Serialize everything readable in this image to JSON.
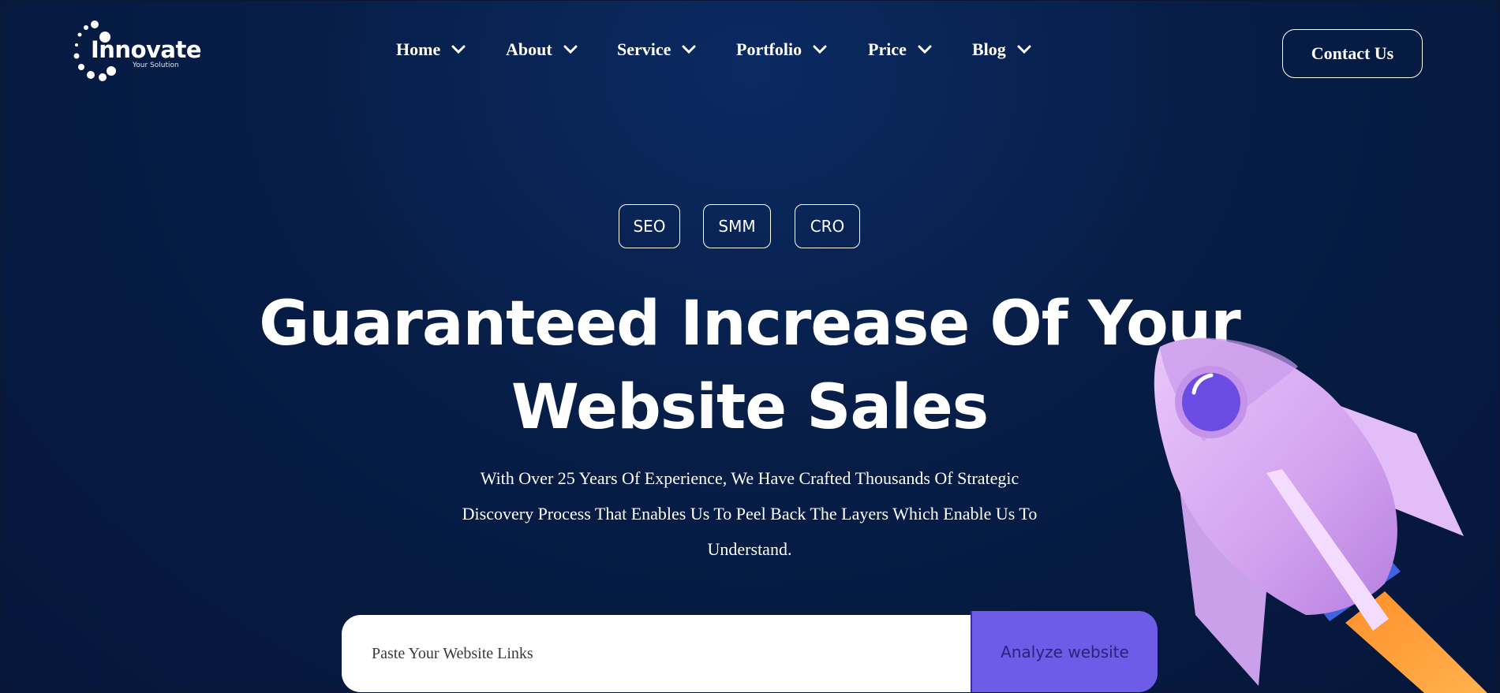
{
  "header": {
    "logo_title": "Innovate",
    "logo_tagline": "Your Solution",
    "nav": [
      {
        "label": "Home"
      },
      {
        "label": "About"
      },
      {
        "label": "Service"
      },
      {
        "label": "Portfolio"
      },
      {
        "label": "Price"
      },
      {
        "label": "Blog"
      }
    ],
    "contact_label": "Contact Us"
  },
  "hero": {
    "tags": [
      "SEO",
      "SMM",
      "CRO"
    ],
    "headline_line1": "Guaranteed Increase Of Your",
    "headline_line2": "Website Sales",
    "subtext_line1": "With Over 25 Years Of Experience, We Have Crafted Thousands Of Strategic",
    "subtext_line2": "Discovery Process That Enables Us To Peel Back The Layers Which Enable Us To",
    "subtext_line3": "Understand.",
    "search_placeholder": "Paste Your Website Links",
    "analyze_label": "Analyze website"
  },
  "colors": {
    "background": "#071d46",
    "accent_button": "#6c5ce7",
    "button_text": "#2c2375",
    "rocket_body": "#d9a8f2",
    "rocket_window": "#6c4de3",
    "rocket_flame": "#ff9d3a"
  },
  "icons": {
    "logo": "dotted-circle-logo-icon",
    "nav_dropdown": "chevron-down-icon",
    "hero_illustration": "rocket-icon"
  }
}
